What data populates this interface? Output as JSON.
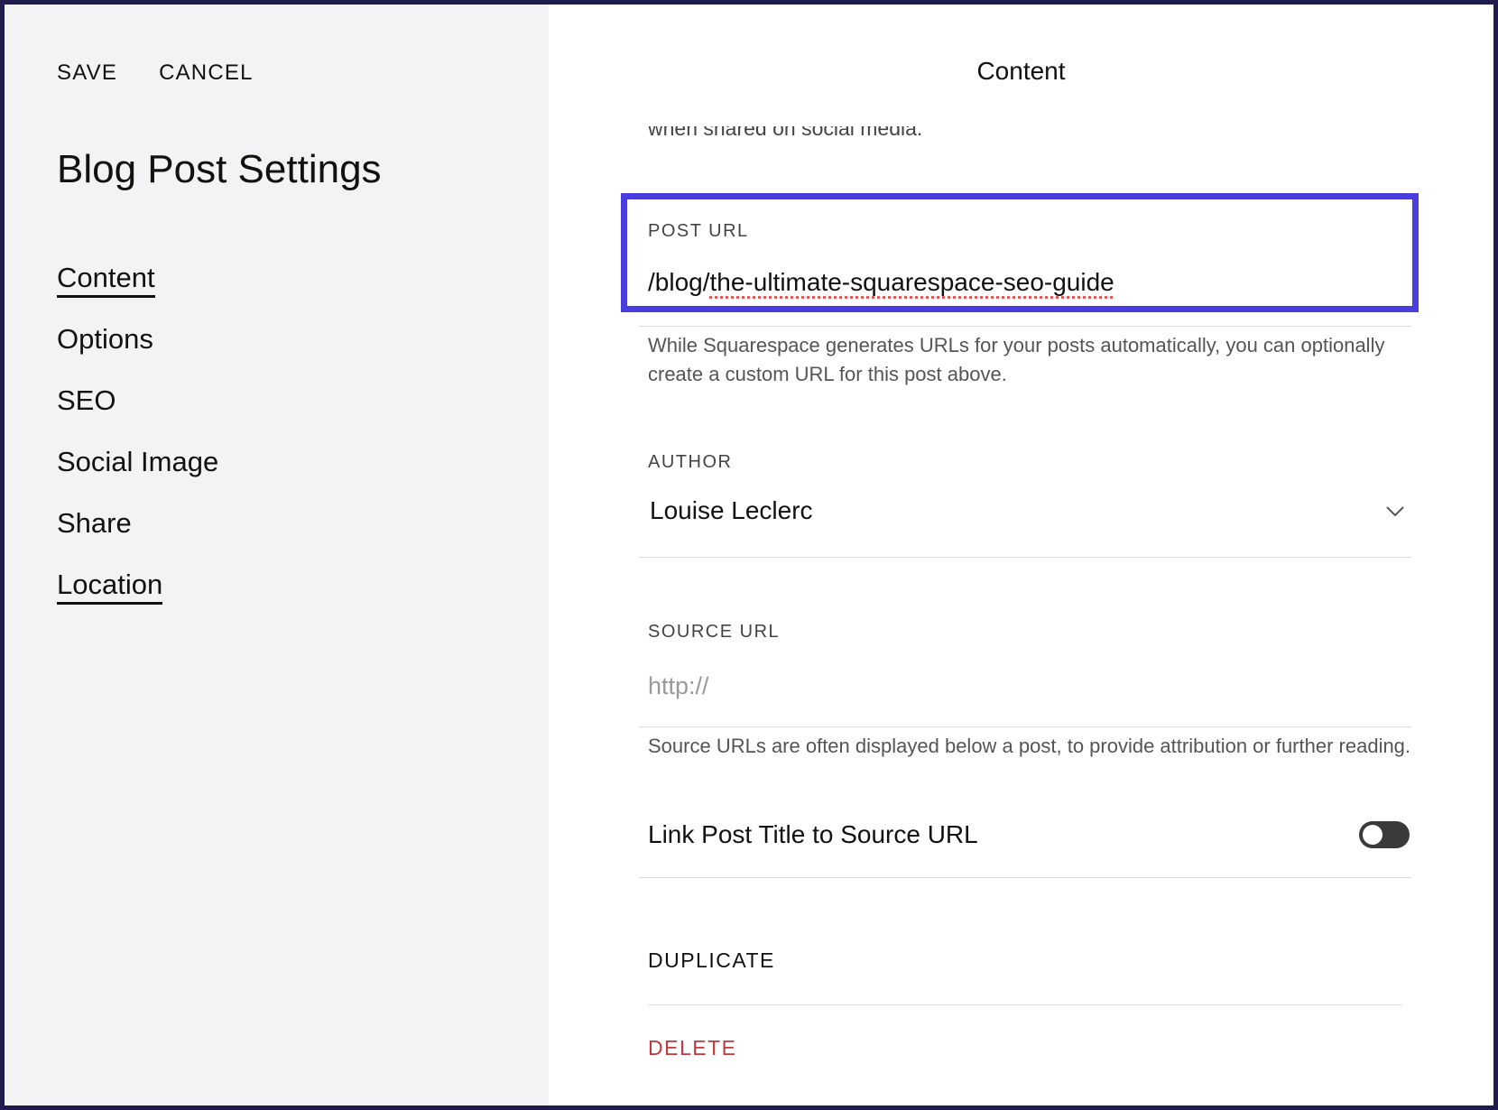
{
  "toolbar": {
    "save_label": "SAVE",
    "cancel_label": "CANCEL"
  },
  "sidebar": {
    "title": "Blog Post Settings",
    "items": [
      {
        "label": "Content"
      },
      {
        "label": "Options"
      },
      {
        "label": "SEO"
      },
      {
        "label": "Social Image"
      },
      {
        "label": "Share"
      },
      {
        "label": "Location"
      }
    ]
  },
  "panel": {
    "title": "Content",
    "clipped_text": "when shared on social media.",
    "post_url": {
      "label": "POST URL",
      "prefix": "/blog/",
      "slug": "the-ultimate-squarespace-seo-guide",
      "help": "While Squarespace generates URLs for your posts automatically, you can optionally create a custom URL for this post above."
    },
    "author": {
      "label": "AUTHOR",
      "value": "Louise Leclerc"
    },
    "source_url": {
      "label": "SOURCE URL",
      "placeholder": "http://",
      "help": "Source URLs are often displayed below a post, to provide attribution or further reading."
    },
    "link_title": {
      "label": "Link Post Title to Source URL",
      "enabled": false
    },
    "duplicate_label": "DUPLICATE",
    "delete_label": "DELETE"
  },
  "colors": {
    "highlight": "#4a3ddd",
    "delete": "#c0393f",
    "sidebar_bg": "#f3f2f5",
    "frame": "#1f1b4d"
  }
}
